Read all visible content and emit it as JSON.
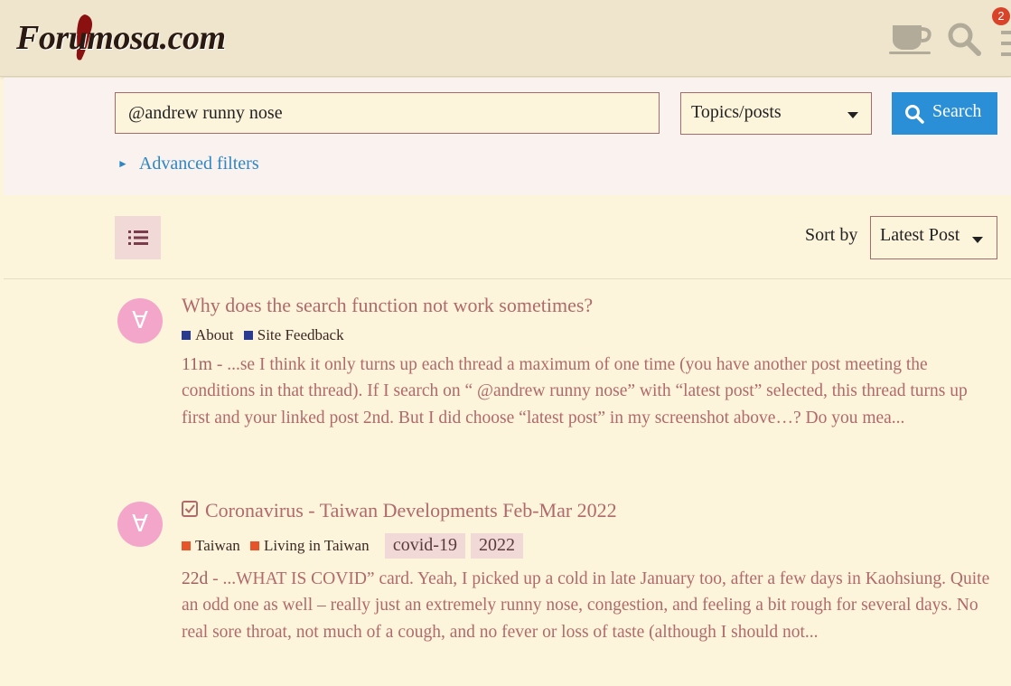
{
  "header": {
    "logo_text": "Forumosa.com",
    "icons": [
      "coffee-cup-icon",
      "search-icon",
      "hamburger-menu-icon"
    ],
    "notification_count": "2"
  },
  "search": {
    "query": "@andrew runny nose",
    "scope": "Topics/posts",
    "button_label": "Search",
    "advanced_filters": "Advanced filters"
  },
  "results_bar": {
    "sort_label": "Sort by",
    "sort_value": "Latest Post"
  },
  "results": [
    {
      "title": "Why does the search function not work sometimes?",
      "avatar_letter": "∀",
      "categories": [
        {
          "name": "About",
          "color": "#2b3b8f"
        },
        {
          "name": "Site Feedback",
          "color": "#2b3b8f"
        }
      ],
      "tags": [],
      "date": "11m",
      "separator": " - ",
      "blurb": "...se I think it only turns up each thread a maximum of one time (you have another post meeting the conditions in that thread). If I search on “ @andrew runny nose” with “latest post” selected, this thread turns up first and your linked post 2nd. But I did choose “latest post” in my screenshot above…? Do you mea..."
    },
    {
      "title": "Coronavirus - Taiwan Developments Feb-Mar 2022",
      "solved_icon": "check-box-icon",
      "avatar_letter": "∀",
      "categories": [
        {
          "name": "Taiwan",
          "color": "#e8542a"
        },
        {
          "name": "Living in Taiwan",
          "color": "#e8542a"
        }
      ],
      "tags": [
        "covid-19",
        "2022"
      ],
      "date": "22d",
      "separator": " - ",
      "blurb": "...WHAT IS COVID” card. Yeah, I picked up a cold in late January too, after a few days in Kaohsiung. Quite an odd one as well – really just an extremely runny nose, congestion, and feeling a bit rough for several days. No real sore throat, not much of a cough, and no fever or loss of taste (although I should not..."
    }
  ],
  "colors": {
    "background": "#fdf4dc",
    "link": "#b06a6a",
    "accent_blue": "#2a8fd6",
    "avatar_pink": "#f3a6c9"
  }
}
